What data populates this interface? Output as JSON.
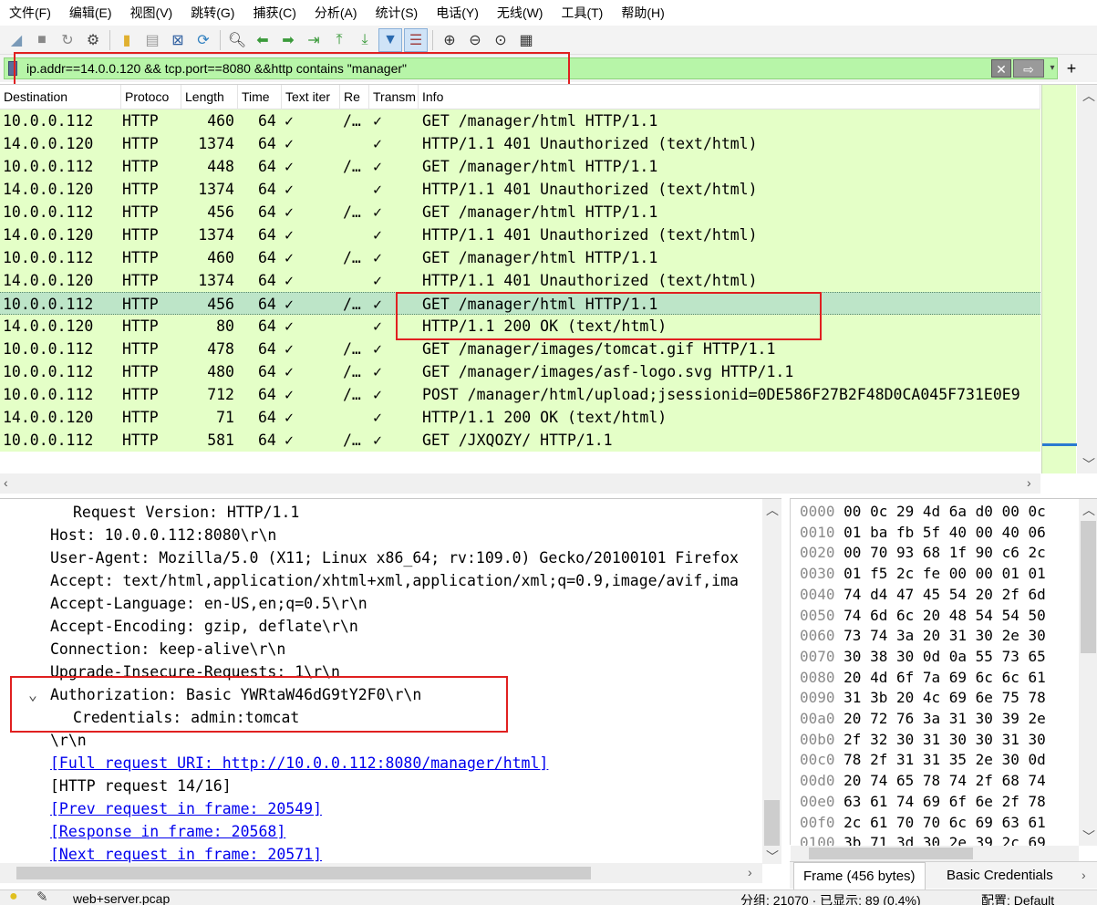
{
  "menu": [
    "文件(F)",
    "编辑(E)",
    "视图(V)",
    "跳转(G)",
    "捕获(C)",
    "分析(A)",
    "统计(S)",
    "电话(Y)",
    "无线(W)",
    "工具(T)",
    "帮助(H)"
  ],
  "toolbar_icons": [
    "shark-fin-start-icon",
    "stop-icon",
    "restart-icon",
    "options-gear-icon",
    "open-folder-icon",
    "file-icon",
    "close-file-icon",
    "reload-icon",
    "find-icon",
    "back-arrow-icon",
    "forward-arrow-icon",
    "goto-packet-icon",
    "first-packet-icon",
    "last-packet-icon",
    "autoscroll-icon",
    "colorize-icon",
    "zoom-in-icon",
    "zoom-out-icon",
    "zoom-normal-icon",
    "resize-columns-icon"
  ],
  "filter": {
    "text": "ip.addr==14.0.0.120 && tcp.port==8080 &&http contains \"manager\"",
    "clear_label": "✕",
    "apply_label": "⇨",
    "dropdown_label": "▾",
    "add_label": "+"
  },
  "columns": [
    "Destination",
    "Protoco",
    "Length",
    "Time",
    "Text iter",
    "Re",
    "Transm",
    "Info"
  ],
  "packets": [
    {
      "dst": "10.0.0.112",
      "proto": "HTTP",
      "len": "460",
      "time": "64",
      "check": "✓",
      "req": "/…",
      "tr": "✓",
      "info": "GET /manager/html HTTP/1.1"
    },
    {
      "dst": "14.0.0.120",
      "proto": "HTTP",
      "len": "1374",
      "time": "64",
      "check": "✓",
      "req": "",
      "tr": "✓",
      "info": "HTTP/1.1 401 Unauthorized  (text/html)"
    },
    {
      "dst": "10.0.0.112",
      "proto": "HTTP",
      "len": "448",
      "time": "64",
      "check": "✓",
      "req": "/…",
      "tr": "✓",
      "info": "GET /manager/html HTTP/1.1"
    },
    {
      "dst": "14.0.0.120",
      "proto": "HTTP",
      "len": "1374",
      "time": "64",
      "check": "✓",
      "req": "",
      "tr": "✓",
      "info": "HTTP/1.1 401 Unauthorized  (text/html)"
    },
    {
      "dst": "10.0.0.112",
      "proto": "HTTP",
      "len": "456",
      "time": "64",
      "check": "✓",
      "req": "/…",
      "tr": "✓",
      "info": "GET /manager/html HTTP/1.1"
    },
    {
      "dst": "14.0.0.120",
      "proto": "HTTP",
      "len": "1374",
      "time": "64",
      "check": "✓",
      "req": "",
      "tr": "✓",
      "info": "HTTP/1.1 401 Unauthorized  (text/html)"
    },
    {
      "dst": "10.0.0.112",
      "proto": "HTTP",
      "len": "460",
      "time": "64",
      "check": "✓",
      "req": "/…",
      "tr": "✓",
      "info": "GET /manager/html HTTP/1.1"
    },
    {
      "dst": "14.0.0.120",
      "proto": "HTTP",
      "len": "1374",
      "time": "64",
      "check": "✓",
      "req": "",
      "tr": "✓",
      "info": "HTTP/1.1 401 Unauthorized  (text/html)"
    },
    {
      "dst": "10.0.0.112",
      "proto": "HTTP",
      "len": "456",
      "time": "64",
      "check": "✓",
      "req": "/…",
      "tr": "✓",
      "info": "GET /manager/html HTTP/1.1",
      "selected": true
    },
    {
      "dst": "14.0.0.120",
      "proto": "HTTP",
      "len": "80",
      "time": "64",
      "check": "✓",
      "req": "",
      "tr": "✓",
      "info": "HTTP/1.1 200 OK  (text/html)"
    },
    {
      "dst": "10.0.0.112",
      "proto": "HTTP",
      "len": "478",
      "time": "64",
      "check": "✓",
      "req": "/…",
      "tr": "✓",
      "info": "GET /manager/images/tomcat.gif HTTP/1.1"
    },
    {
      "dst": "10.0.0.112",
      "proto": "HTTP",
      "len": "480",
      "time": "64",
      "check": "✓",
      "req": "/…",
      "tr": "✓",
      "info": "GET /manager/images/asf-logo.svg HTTP/1.1"
    },
    {
      "dst": "10.0.0.112",
      "proto": "HTTP",
      "len": "712",
      "time": "64",
      "check": "✓",
      "req": "/…",
      "tr": "✓",
      "info": "POST /manager/html/upload;jsessionid=0DE586F27B2F48D0CA045F731E0E9"
    },
    {
      "dst": "14.0.0.120",
      "proto": "HTTP",
      "len": "71",
      "time": "64",
      "check": "✓",
      "req": "",
      "tr": "✓",
      "info": "HTTP/1.1 200 OK  (text/html)"
    },
    {
      "dst": "10.0.0.112",
      "proto": "HTTP",
      "len": "581",
      "time": "64",
      "check": "✓",
      "req": "/…",
      "tr": "✓",
      "info": "GET /JXQOZY/ HTTP/1.1"
    }
  ],
  "details": [
    {
      "indent": 80,
      "text": "Request Version: HTTP/1.1"
    },
    {
      "indent": 55,
      "text": "Host: 10.0.0.112:8080\\r\\n"
    },
    {
      "indent": 55,
      "text": "User-Agent: Mozilla/5.0 (X11; Linux x86_64; rv:109.0) Gecko/20100101 Firefox"
    },
    {
      "indent": 55,
      "text": "Accept: text/html,application/xhtml+xml,application/xml;q=0.9,image/avif,ima"
    },
    {
      "indent": 55,
      "text": "Accept-Language: en-US,en;q=0.5\\r\\n"
    },
    {
      "indent": 55,
      "text": "Accept-Encoding: gzip, deflate\\r\\n"
    },
    {
      "indent": 55,
      "text": "Connection: keep-alive\\r\\n"
    },
    {
      "indent": 55,
      "text": "Upgrade-Insecure-Requests: 1\\r\\n"
    },
    {
      "indent": 55,
      "text": "Authorization: Basic YWRtaW46dG9tY2F0\\r\\n",
      "expander": "⌄"
    },
    {
      "indent": 80,
      "text": "Credentials: admin:tomcat"
    },
    {
      "indent": 55,
      "text": "\\r\\n"
    },
    {
      "indent": 55,
      "text": "[Full request URI: http://10.0.0.112:8080/manager/html]",
      "link": true
    },
    {
      "indent": 55,
      "text": "[HTTP request 14/16]"
    },
    {
      "indent": 55,
      "text": "[Prev request in frame: 20549]",
      "link": true
    },
    {
      "indent": 55,
      "text": "[Response in frame: 20568]",
      "link": true
    },
    {
      "indent": 55,
      "text": "[Next request in frame: 20571]",
      "link": true
    }
  ],
  "hex": [
    {
      "off": "0000",
      "bytes": "00 0c 29 4d 6a d0 00 0c"
    },
    {
      "off": "0010",
      "bytes": "01 ba fb 5f 40 00 40 06"
    },
    {
      "off": "0020",
      "bytes": "00 70 93 68 1f 90 c6 2c"
    },
    {
      "off": "0030",
      "bytes": "01 f5 2c fe 00 00 01 01"
    },
    {
      "off": "0040",
      "bytes": "74 d4 47 45 54 20 2f 6d"
    },
    {
      "off": "0050",
      "bytes": "74 6d 6c 20 48 54 54 50"
    },
    {
      "off": "0060",
      "bytes": "73 74 3a 20 31 30 2e 30"
    },
    {
      "off": "0070",
      "bytes": "30 38 30 0d 0a 55 73 65"
    },
    {
      "off": "0080",
      "bytes": "20 4d 6f 7a 69 6c 6c 61"
    },
    {
      "off": "0090",
      "bytes": "31 3b 20 4c 69 6e 75 78"
    },
    {
      "off": "00a0",
      "bytes": "20 72 76 3a 31 30 39 2e"
    },
    {
      "off": "00b0",
      "bytes": "2f 32 30 31 30 30 31 30"
    },
    {
      "off": "00c0",
      "bytes": "78 2f 31 31 35 2e 30 0d"
    },
    {
      "off": "00d0",
      "bytes": "20 74 65 78 74 2f 68 74"
    },
    {
      "off": "00e0",
      "bytes": "63 61 74 69 6f 6e 2f 78"
    },
    {
      "off": "00f0",
      "bytes": "2c 61 70 70 6c 69 63 61"
    },
    {
      "off": "0100",
      "bytes": "3b 71 3d 30 2e 39 2c 69"
    }
  ],
  "hex_tabs": {
    "frame": "Frame (456 bytes)",
    "creds": "Basic Credentials"
  },
  "status": {
    "file": "web+server.pcap",
    "stats": "分组: 21070 · 已显示: 89 (0.4%)",
    "profile": "配置: Default"
  }
}
